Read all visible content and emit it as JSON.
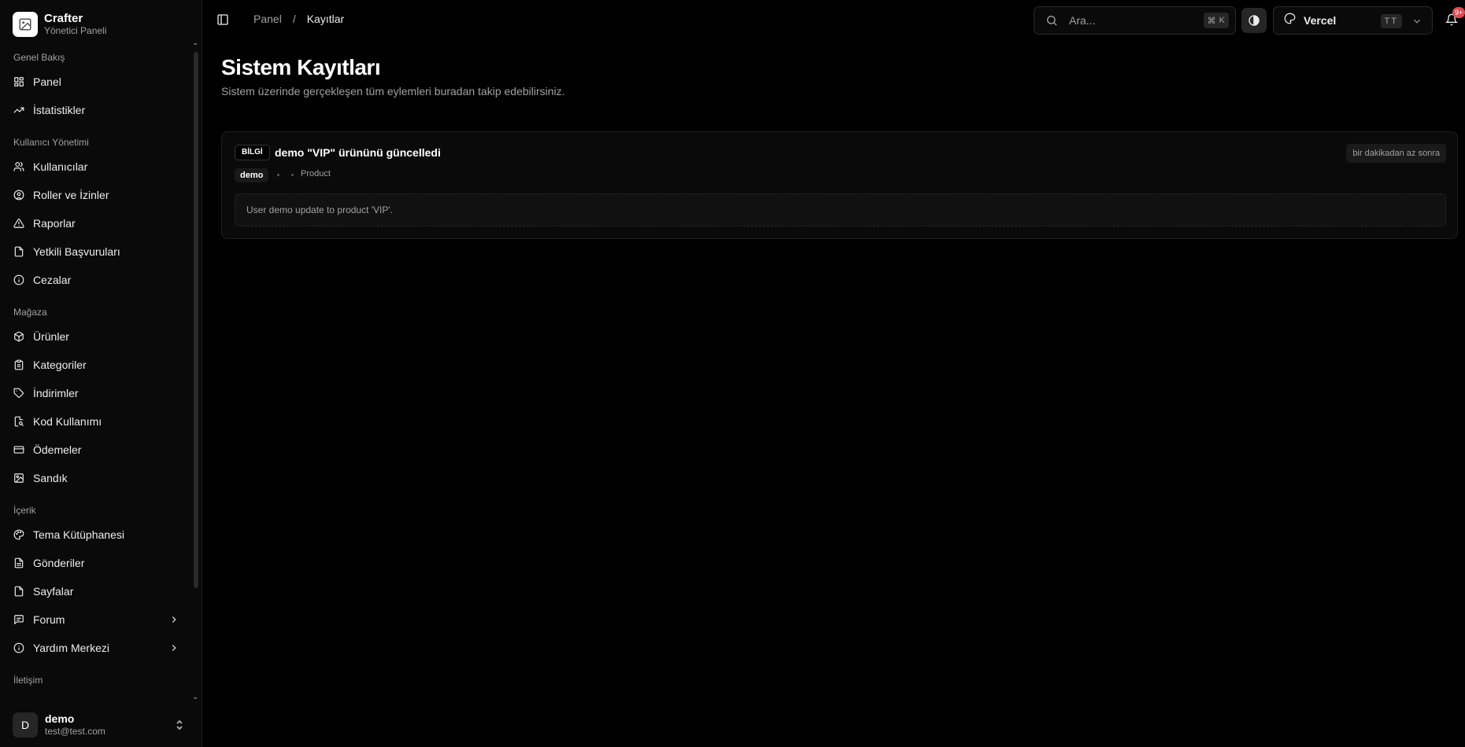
{
  "brand": {
    "name": "Crafter",
    "subtitle": "Yönetici Paneli"
  },
  "sidebar": {
    "groups": [
      {
        "label": "Genel Bakış",
        "items": [
          {
            "label": "Panel",
            "icon": "layout-dashboard-icon"
          },
          {
            "label": "İstatistikler",
            "icon": "trending-up-icon"
          }
        ]
      },
      {
        "label": "Kullanıcı Yönetimi",
        "items": [
          {
            "label": "Kullanıcılar",
            "icon": "users-icon"
          },
          {
            "label": "Roller ve İzinler",
            "icon": "user-circle-icon"
          },
          {
            "label": "Raporlar",
            "icon": "alert-triangle-icon"
          },
          {
            "label": "Yetkili Başvuruları",
            "icon": "file-icon"
          },
          {
            "label": "Cezalar",
            "icon": "info-circle-icon"
          }
        ]
      },
      {
        "label": "Mağaza",
        "items": [
          {
            "label": "Ürünler",
            "icon": "box-icon"
          },
          {
            "label": "Kategoriler",
            "icon": "clipboard-icon"
          },
          {
            "label": "İndirimler",
            "icon": "tag-icon"
          },
          {
            "label": "Kod Kullanımı",
            "icon": "file-search-icon"
          },
          {
            "label": "Ödemeler",
            "icon": "credit-card-icon"
          },
          {
            "label": "Sandık",
            "icon": "image-icon"
          }
        ]
      },
      {
        "label": "İçerik",
        "items": [
          {
            "label": "Tema Kütüphanesi",
            "icon": "palette-icon"
          },
          {
            "label": "Gönderiler",
            "icon": "file-text-icon"
          },
          {
            "label": "Sayfalar",
            "icon": "file-icon"
          },
          {
            "label": "Forum",
            "icon": "message-square-icon",
            "expandable": true
          },
          {
            "label": "Yardım Merkezi",
            "icon": "info-circle-icon",
            "expandable": true
          }
        ]
      },
      {
        "label": "İletişim",
        "items": []
      }
    ]
  },
  "user": {
    "initial": "D",
    "name": "demo",
    "email": "test@test.com"
  },
  "header": {
    "breadcrumb": {
      "parent": "Panel",
      "separator": "/",
      "current": "Kayıtlar"
    },
    "search": {
      "placeholder": "Ara...",
      "shortcut_symbol": "⌘",
      "shortcut_key": "K"
    },
    "theme_select": {
      "label": "Vercel",
      "badge": "TT"
    },
    "notifications": {
      "badge": "9+"
    }
  },
  "main": {
    "title": "Sistem Kayıtları",
    "description": "Sistem üzerinde gerçekleşen tüm eylemleri buradan takip edebilirsiniz.",
    "logs": [
      {
        "level": "BİLGİ",
        "title": "demo \"VIP\" ürününü güncelledi",
        "time": "bir dakikadan az sonra",
        "user": "demo",
        "type": "Product",
        "detail": "User demo update to product 'VIP'."
      }
    ]
  }
}
